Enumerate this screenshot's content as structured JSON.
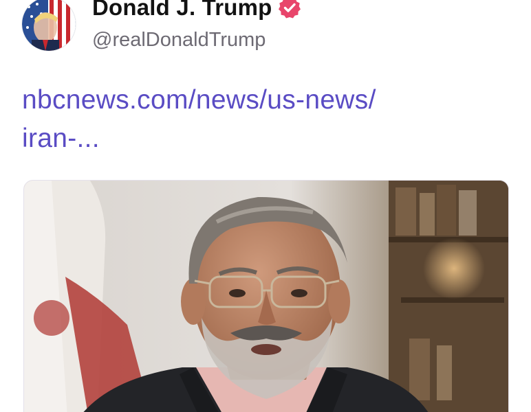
{
  "post": {
    "author": {
      "display_name": "Donald J. Trump",
      "handle": "@realDonaldTrump",
      "verified": true,
      "verified_badge_color": "#e8456b"
    },
    "link": {
      "line1": "nbcnews.com/news/us-news/",
      "line2": "iran-...",
      "color": "#5a4cc4"
    },
    "preview": {
      "icon": "link-preview-photo"
    }
  },
  "colors": {
    "background": "#ffffff",
    "name_text": "#121212",
    "handle_text": "#6d6a73"
  }
}
